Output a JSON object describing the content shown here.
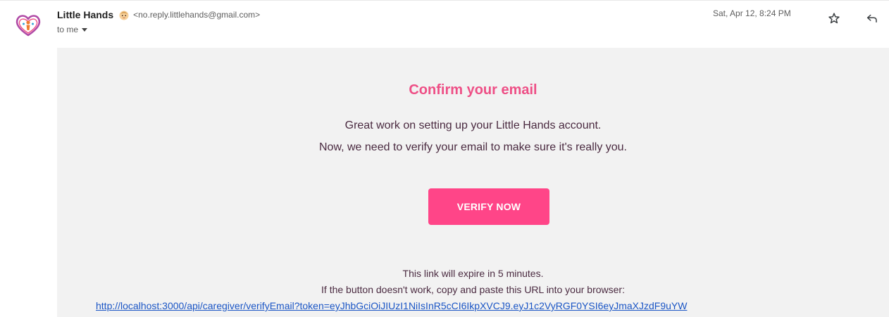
{
  "header": {
    "sender_name": "Little Hands",
    "sender_email": "<no.reply.littlehands@gmail.com>",
    "recipient": "to me",
    "date": "Sat, Apr 12, 8:24 PM"
  },
  "icons": {
    "avatar": "little-hands-heart-logo",
    "sender_badge": "baby-emoji",
    "recipient_details": "caret-down",
    "star": "star-outline",
    "reply": "reply-arrow"
  },
  "email": {
    "title": "Confirm your email",
    "message_line_1": "Great work on setting up your Little Hands account.",
    "message_line_2": "Now, we need to verify your email to make sure it's really you.",
    "button_label": "VERIFY NOW",
    "expiry_text": "This link will expire in 5 minutes.",
    "fallback_text": "If the button doesn't work, copy and paste this URL into your browser:",
    "verify_url": "http://localhost:3000/api/caregiver/verifyEmail?token=eyJhbGciOiJIUzI1NiIsInR5cCI6IkpXVCJ9.eyJ1c2VyRGF0YSI6eyJmaXJzdF9uYW"
  },
  "colors": {
    "accent": "#ff4588",
    "title": "#ee4f86",
    "body_text": "#4a2a40",
    "link": "#1a55c5",
    "email_background": "#f2f2f2"
  }
}
